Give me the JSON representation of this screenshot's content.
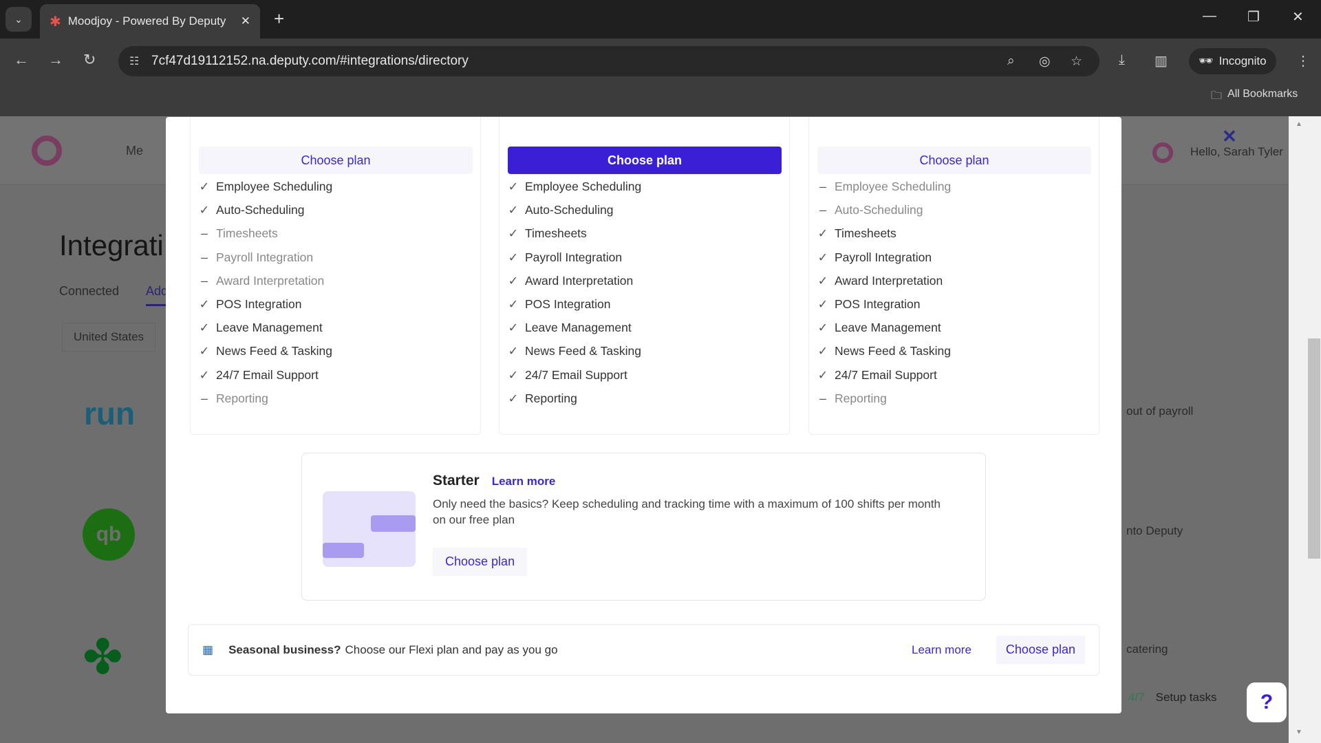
{
  "browser": {
    "tab_title": "Moodjoy - Powered By Deputy",
    "url": "7cf47d19112152.na.deputy.com/#integrations/directory",
    "incognito_label": "Incognito",
    "bookmarks_label": "All Bookmarks"
  },
  "background": {
    "nav_me": "Me",
    "greeting": "Hello, Sarah Tyler",
    "page_title": "Integrati",
    "tabs": [
      "Connected",
      "Add"
    ],
    "country": "United States",
    "snippets": [
      "out of payroll",
      "nto Deputy",
      "catering"
    ],
    "setup_count": "4/7",
    "setup_label": "Setup tasks",
    "help": "?"
  },
  "modal": {
    "choose_label": "Choose plan",
    "features": [
      "Employee Scheduling",
      "Auto-Scheduling",
      "Timesheets",
      "Payroll Integration",
      "Award Interpretation",
      "POS Integration",
      "Leave Management",
      "News Feed & Tasking",
      "24/7 Email Support",
      "Reporting"
    ],
    "plans": [
      {
        "included": [
          true,
          true,
          false,
          false,
          false,
          true,
          true,
          true,
          true,
          false
        ]
      },
      {
        "included": [
          true,
          true,
          true,
          true,
          true,
          true,
          true,
          true,
          true,
          true
        ],
        "highlighted": true
      },
      {
        "included": [
          false,
          false,
          true,
          true,
          true,
          true,
          true,
          true,
          true,
          false
        ]
      }
    ],
    "starter": {
      "title": "Starter",
      "learn_more": "Learn more",
      "description": "Only need the basics? Keep scheduling and tracking time with a maximum of 100 shifts per month on our free plan",
      "choose": "Choose plan"
    },
    "flexi": {
      "bold": "Seasonal business?",
      "text": "Choose our Flexi plan and pay as you go",
      "learn_more": "Learn more",
      "choose": "Choose plan"
    }
  },
  "colors": {
    "accent": "#3b1fd6"
  }
}
